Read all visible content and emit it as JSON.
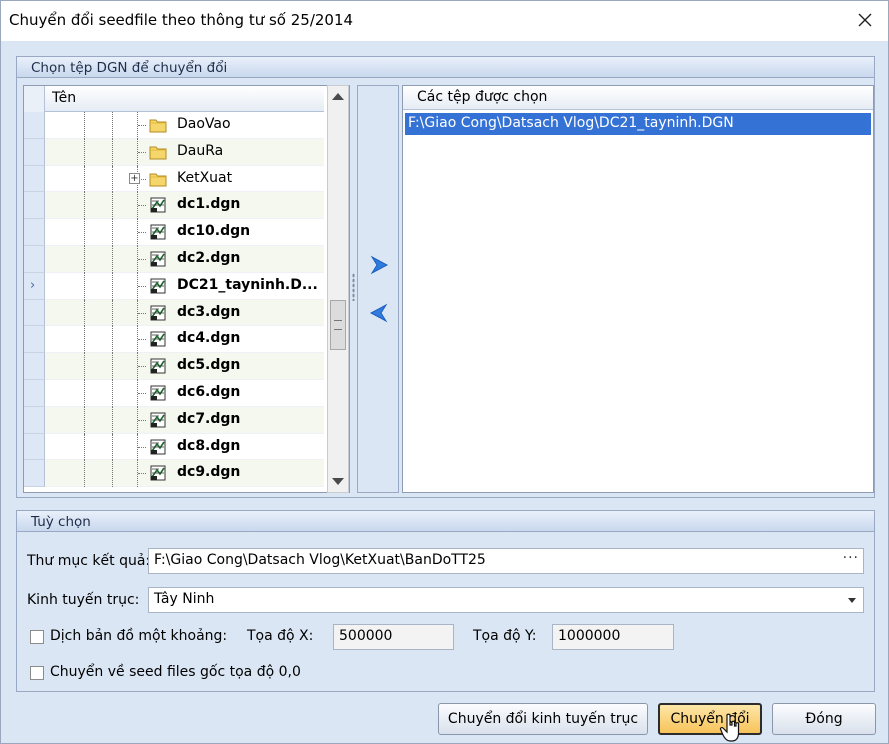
{
  "window": {
    "title": "Chuyển đổi seedfile theo thông tư số 25/2014"
  },
  "file_group": {
    "header": "Chọn tệp DGN để chuyển đổi",
    "tree": {
      "column_header": "Tên",
      "rows": [
        {
          "label": "DaoVao",
          "type": "folder",
          "bold": false,
          "expandable": false
        },
        {
          "label": "DauRa",
          "type": "folder",
          "bold": false,
          "expandable": false
        },
        {
          "label": "KetXuat",
          "type": "folder",
          "bold": false,
          "expandable": true
        },
        {
          "label": "dc1.dgn",
          "type": "dgn",
          "bold": true
        },
        {
          "label": "dc10.dgn",
          "type": "dgn",
          "bold": true
        },
        {
          "label": "dc2.dgn",
          "type": "dgn",
          "bold": true
        },
        {
          "label": "DC21_tayninh.D...",
          "type": "dgn",
          "bold": true,
          "current": true
        },
        {
          "label": "dc3.dgn",
          "type": "dgn",
          "bold": true
        },
        {
          "label": "dc4.dgn",
          "type": "dgn",
          "bold": true
        },
        {
          "label": "dc5.dgn",
          "type": "dgn",
          "bold": true
        },
        {
          "label": "dc6.dgn",
          "type": "dgn",
          "bold": true
        },
        {
          "label": "dc7.dgn",
          "type": "dgn",
          "bold": true
        },
        {
          "label": "dc8.dgn",
          "type": "dgn",
          "bold": true
        },
        {
          "label": "dc9.dgn",
          "type": "dgn",
          "bold": true
        }
      ]
    },
    "selected": {
      "header": "Các tệp được chọn",
      "items": [
        "F:\\Giao Cong\\Datsach Vlog\\DC21_tayninh.DGN"
      ]
    }
  },
  "options": {
    "header": "Tuỳ chọn",
    "output_folder_label": "Thư mục kết quả:",
    "output_folder_value": "F:\\Giao Cong\\Datsach Vlog\\KetXuat\\BanDoTT25",
    "browse_label": "···",
    "meridian_label": "Kinh tuyến trục:",
    "meridian_value": "Tây Ninh",
    "shift_label": "Dịch bản đồ một khoảng:",
    "x_label": "Tọa độ X:",
    "x_value": "500000",
    "y_label": "Tọa độ Y:",
    "y_value": "1000000",
    "origin_label": "Chuyển về seed files gốc tọa độ 0,0"
  },
  "buttons": {
    "convert_meridian": "Chuyển đổi kinh tuyến trục",
    "convert": "Chuyển đổi",
    "close": "Đóng"
  },
  "colors": {
    "accent": "#3572d6",
    "primary_button": "#f7c359",
    "panel": "#dbe6f5"
  }
}
